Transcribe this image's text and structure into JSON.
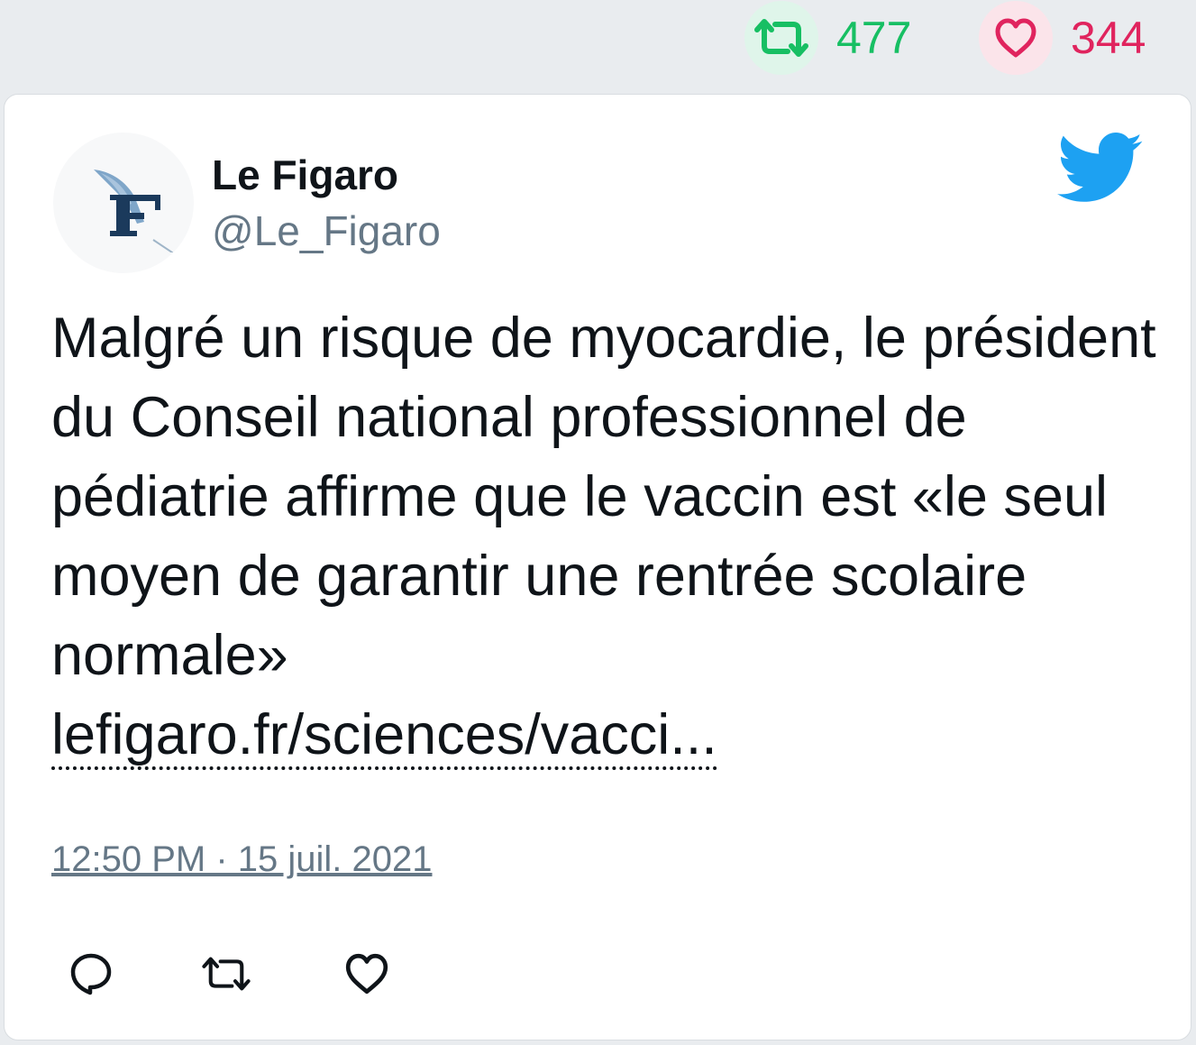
{
  "stats": {
    "retweet_count": "477",
    "like_count": "344",
    "retweet_icon": "retweet-icon",
    "like_icon": "heart-icon"
  },
  "author": {
    "name": "Le Figaro",
    "handle": "@Le_Figaro",
    "avatar_letter": "F"
  },
  "tweet": {
    "text": "Malgré un risque de myocardie, le président du Conseil national professionnel de pédiatrie affirme que le vaccin est «le seul moyen de garantir une rentrée scolaire normale»",
    "link_text": "lefigaro.fr/sciences/vacci...",
    "timestamp": "12:50 PM · 15 juil. 2021"
  },
  "actions": {
    "reply_icon": "reply-icon",
    "retweet_icon": "retweet-icon",
    "like_icon": "heart-icon"
  },
  "colors": {
    "retweet_green": "#17bf63",
    "like_red": "#e0245e",
    "twitter_blue": "#1da1f2",
    "handle_grey": "#657786",
    "figaro_navy": "#1b3a5c"
  }
}
